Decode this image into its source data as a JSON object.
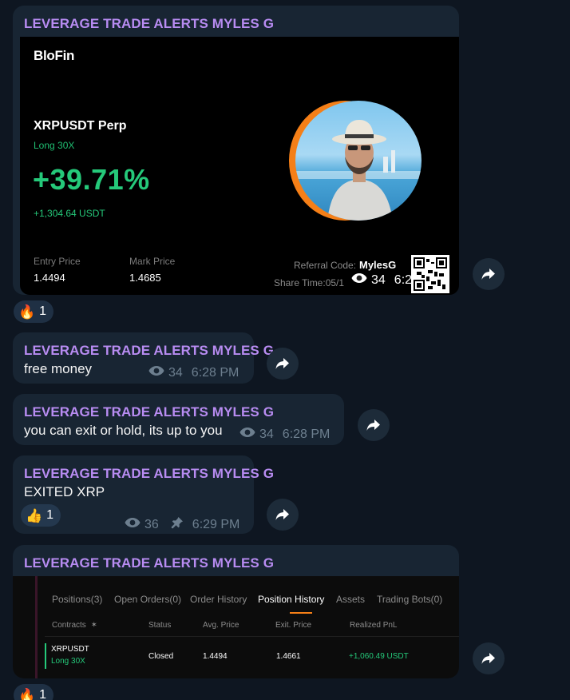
{
  "channel_name": "LEVERAGE TRADE ALERTS MYLES G",
  "messages": {
    "m1": {
      "sender": "LEVERAGE TRADE ALERTS MYLES G",
      "views": "34",
      "time": "6:28 PM",
      "reaction": {
        "emoji": "🔥",
        "count": "1"
      },
      "card": {
        "brand": "BloFin",
        "pair": "XRPUSDT Perp",
        "side": "Long 30X",
        "pnl_percent": "+39.71%",
        "pnl_usdt": "+1,304.64 USDT",
        "entry_label": "Entry Price",
        "entry_value": "1.4494",
        "mark_label": "Mark Price",
        "mark_value": "1.4685",
        "referral_label": "Referral Code:",
        "referral_code": "MylesG",
        "share_time": "Share Time:05/1"
      }
    },
    "m2": {
      "sender": "LEVERAGE TRADE ALERTS MYLES G",
      "text": "free money",
      "views": "34",
      "time": "6:28 PM"
    },
    "m3": {
      "sender": "LEVERAGE TRADE ALERTS MYLES G",
      "text": "you can exit or hold, its up to you",
      "views": "34",
      "time": "6:28 PM"
    },
    "m4": {
      "sender": "LEVERAGE TRADE ALERTS MYLES G",
      "text": "EXITED XRP",
      "views": "36",
      "time": "6:29 PM",
      "reaction": {
        "emoji": "👍",
        "count": "1"
      }
    },
    "m5": {
      "sender": "LEVERAGE TRADE ALERTS MYLES G",
      "reaction": {
        "emoji": "🔥",
        "count": "1"
      },
      "card": {
        "tabs": [
          "Positions(3)",
          "Open Orders(0)",
          "Order History",
          "Position History",
          "Assets",
          "Trading Bots(0)"
        ],
        "active_tab": "Position History",
        "headers": [
          "Contracts",
          "Status",
          "Avg. Price",
          "Exit. Price",
          "Realized PnL"
        ],
        "row": {
          "contract": "XRPUSDT",
          "side": "Long 30X",
          "status": "Closed",
          "avg_price": "1.4494",
          "exit_price": "1.4661",
          "realized_pnl": "+1,060.49 USDT"
        }
      }
    }
  },
  "colors": {
    "background": "#0e1621",
    "bubble": "#182533",
    "sender": "#b88cf2",
    "profit": "#25c97a",
    "accent": "#f57f17"
  },
  "icons": {
    "views": "eye-icon",
    "forward": "share-arrow-icon",
    "pinned": "pin-icon"
  }
}
